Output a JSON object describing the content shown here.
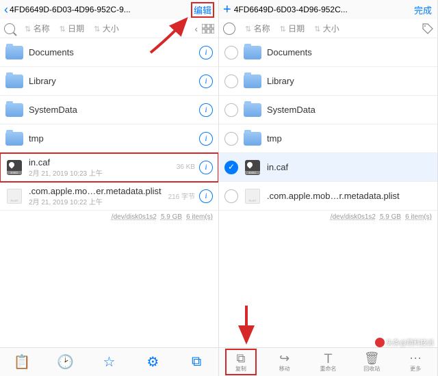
{
  "left": {
    "title": "4FD6649D-6D03-4D96-952C-9...",
    "action": "编辑",
    "sort": {
      "name": "名称",
      "date": "日期",
      "size": "大小"
    },
    "rows": [
      {
        "type": "folder",
        "name": "Documents"
      },
      {
        "type": "folder",
        "name": "Library"
      },
      {
        "type": "folder",
        "name": "SystemData"
      },
      {
        "type": "folder",
        "name": "tmp"
      },
      {
        "type": "exec",
        "name": "in.caf",
        "sub": "2月 21, 2019 10:23 上午",
        "size": "36 KB"
      },
      {
        "type": "plist",
        "name": ".com.apple.mo…er.metadata.plist",
        "sub": "2月 21, 2019 10:22 上午",
        "size": "216 字节"
      }
    ],
    "footer": {
      "dev": "/dev/disk0s1s2",
      "size": "5.9 GB",
      "count": "6 item(s)"
    }
  },
  "right": {
    "title": "4FD6649D-6D03-4D96-952C...",
    "action": "完成",
    "sort": {
      "name": "名称",
      "date": "日期",
      "size": "大小"
    },
    "rows": [
      {
        "type": "folder",
        "name": "Documents",
        "checked": false
      },
      {
        "type": "folder",
        "name": "Library",
        "checked": false
      },
      {
        "type": "folder",
        "name": "SystemData",
        "checked": false
      },
      {
        "type": "folder",
        "name": "tmp",
        "checked": false
      },
      {
        "type": "exec",
        "name": "in.caf",
        "checked": true
      },
      {
        "type": "plist",
        "name": ".com.apple.mob…r.metadata.plist",
        "checked": false
      }
    ],
    "footer": {
      "dev": "/dev/disk0s1s2",
      "size": "5.9 GB",
      "count": "6 item(s)"
    },
    "toolbar": [
      {
        "key": "copy",
        "label": "复制"
      },
      {
        "key": "move",
        "label": "移动"
      },
      {
        "key": "rename",
        "label": "重命名"
      },
      {
        "key": "trash",
        "label": "回收站"
      },
      {
        "key": "more",
        "label": "更多"
      }
    ]
  },
  "watermark": "头条@简科技派"
}
